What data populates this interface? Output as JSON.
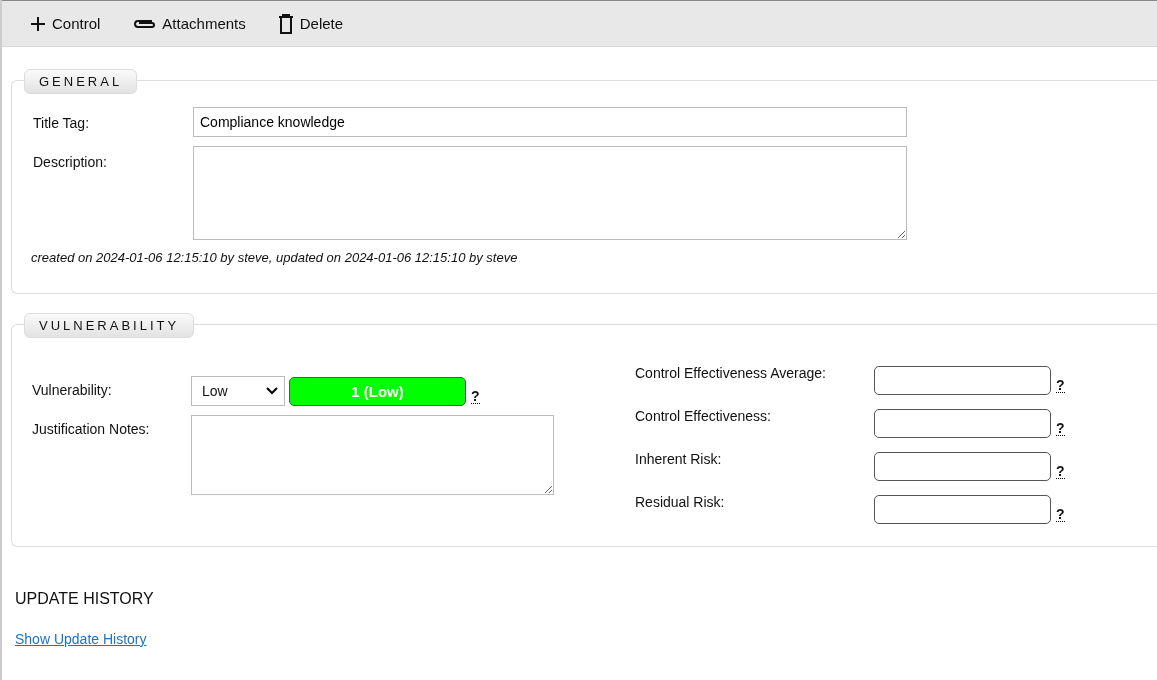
{
  "toolbar": [
    {
      "kind": "add",
      "label": "Control"
    },
    {
      "kind": "attach",
      "label": "Attachments"
    },
    {
      "kind": "delete",
      "label": "Delete"
    }
  ],
  "general": {
    "legend": "GENERAL",
    "fields": [
      {
        "kind": "input",
        "label": "Title Tag:",
        "value": "Compliance knowledge"
      },
      {
        "kind": "textarea",
        "label": "Description:"
      }
    ],
    "meta": "created on 2024-01-06 12:15:10 by steve, updated on 2024-01-06 12:15:10 by steve"
  },
  "vulnerability": {
    "legend": "VULNERABILITY",
    "vulnerability_label": "Vulnerability:",
    "select_value": "Low",
    "score": {
      "text": "1 (Low)",
      "color": "#00ff00"
    },
    "help": "?",
    "notes_label": "Justification Notes:",
    "metrics": [
      {
        "label": "Control Effectiveness Average:",
        "help": "?"
      },
      {
        "label": "Control Effectiveness:",
        "help": "?"
      },
      {
        "label": "Inherent Risk:",
        "help": "?"
      },
      {
        "label": "Residual Risk:",
        "help": "?"
      }
    ]
  },
  "update_history": {
    "title": "UPDATE HISTORY",
    "link": "Show Update History"
  }
}
